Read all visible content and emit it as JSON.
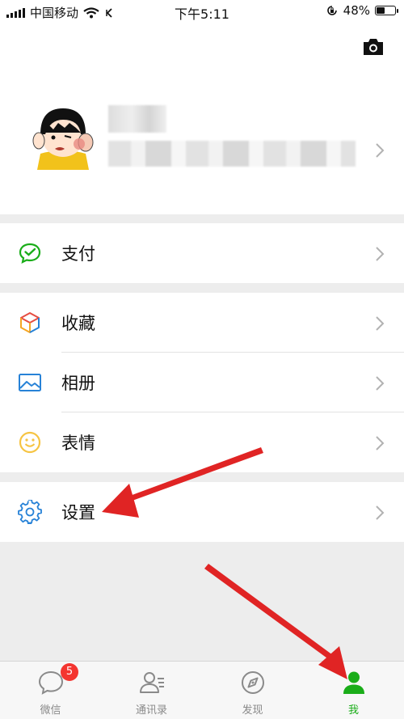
{
  "status_bar": {
    "carrier": "中国移动",
    "time": "下午5:11",
    "battery_percent": "48%",
    "battery_level": 0.48,
    "icons": [
      "signal-icon",
      "wifi-icon",
      "location-arrow-icon",
      "orientation-lock-icon",
      "battery-icon"
    ]
  },
  "profile": {
    "camera_icon": "camera-icon",
    "chevron_icon": "chevron-right-icon"
  },
  "menu": {
    "pay": {
      "label": "支付",
      "icon": "wechat-pay-icon",
      "color": "#1aad19"
    },
    "favorites": {
      "label": "收藏",
      "icon": "favorites-cube-icon"
    },
    "album": {
      "label": "相册",
      "icon": "album-image-icon",
      "color": "#2782d7"
    },
    "stickers": {
      "label": "表情",
      "icon": "smiley-icon",
      "color": "#f6c443"
    },
    "settings": {
      "label": "设置",
      "icon": "gear-icon",
      "color": "#2782d7"
    }
  },
  "tabbar": {
    "tabs": [
      {
        "label": "微信",
        "icon": "chat-bubble-icon",
        "badge": "5"
      },
      {
        "label": "通讯录",
        "icon": "contacts-icon"
      },
      {
        "label": "发现",
        "icon": "compass-icon"
      },
      {
        "label": "我",
        "icon": "me-person-icon",
        "active": true
      }
    ],
    "active_color": "#1aad19"
  },
  "annotation_color": "#e02424"
}
